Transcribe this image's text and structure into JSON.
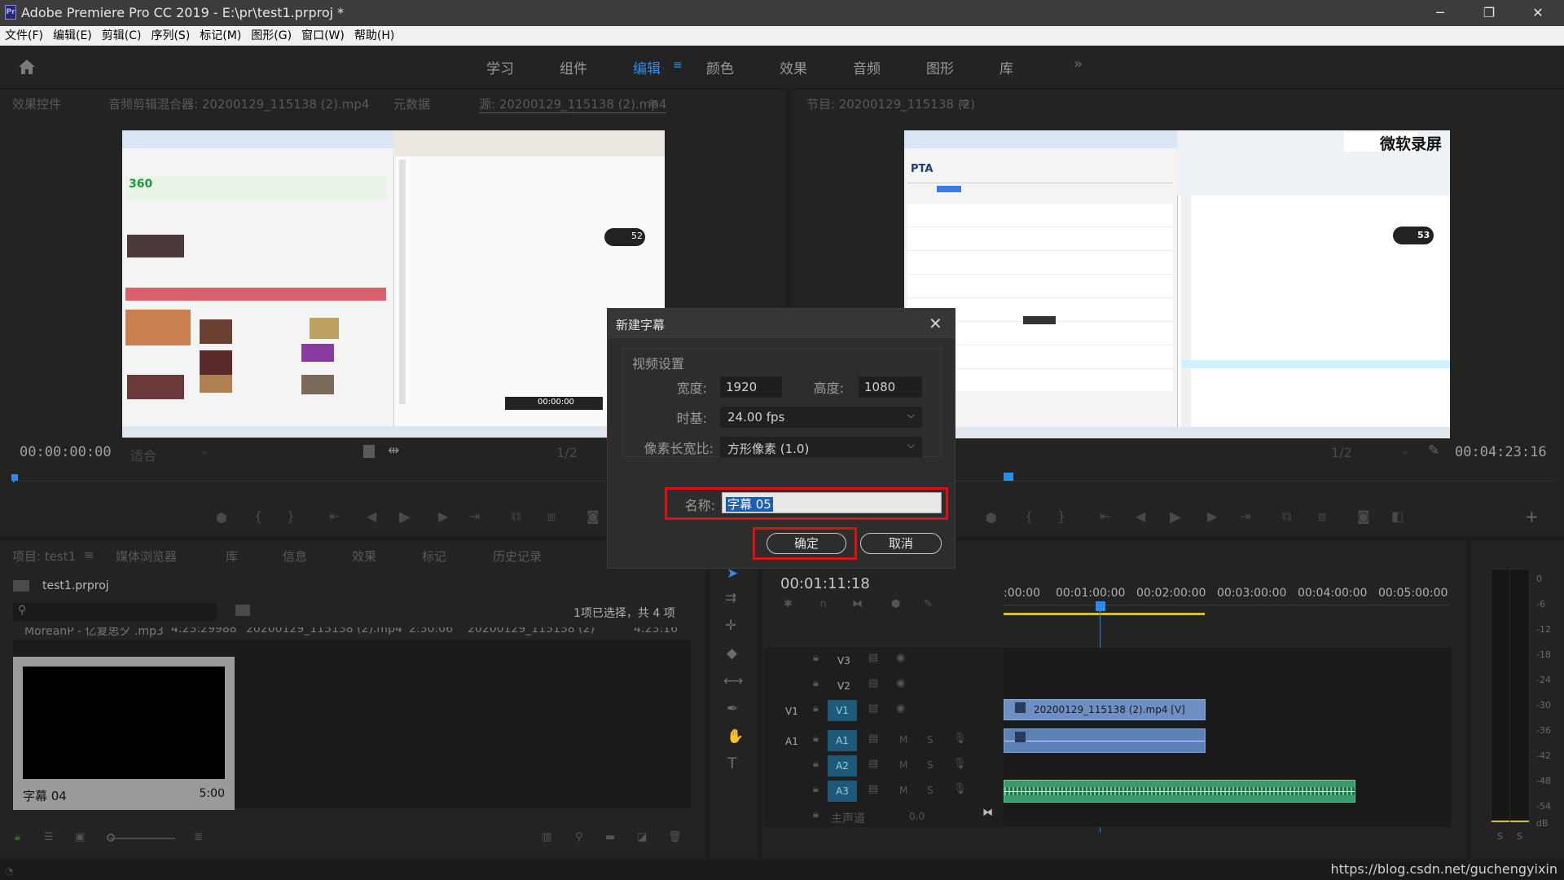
{
  "window": {
    "title": "Adobe Premiere Pro CC 2019 - E:\\pr\\test1.prproj *",
    "app_icon_text": "Pr",
    "minimize": "─",
    "maximize": "❐",
    "close": "✕"
  },
  "menu": [
    "文件(F)",
    "编辑(E)",
    "剪辑(C)",
    "序列(S)",
    "标记(M)",
    "图形(G)",
    "窗口(W)",
    "帮助(H)"
  ],
  "workspaces": [
    {
      "label": "学习",
      "active": false
    },
    {
      "label": "组件",
      "active": false
    },
    {
      "label": "编辑",
      "active": true
    },
    {
      "label": "颜色",
      "active": false
    },
    {
      "label": "效果",
      "active": false
    },
    {
      "label": "音频",
      "active": false
    },
    {
      "label": "图形",
      "active": false
    },
    {
      "label": "库",
      "active": false
    }
  ],
  "workspace_more": "»",
  "source_panel": {
    "tabs": [
      "效果控件",
      "音频剪辑混合器: 20200129_115138 (2).mp4",
      "元数据",
      "源: 20200129_115138 (2).mp4"
    ],
    "timecode": "00:00:00:00",
    "fit": "适合",
    "resolution": "1/2"
  },
  "program_panel": {
    "tab": "节目: 20200129_115138 (2)",
    "timecode": "00:04:23:16",
    "resolution": "1/2",
    "overlay_text": "微软录屏",
    "badge": "53"
  },
  "dialog": {
    "title": "新建字幕",
    "section": "视频设置",
    "width_label": "宽度:",
    "width_value": "1920",
    "height_label": "高度:",
    "height_value": "1080",
    "timebase_label": "时基:",
    "timebase_value": "24.00 fps",
    "pixel_aspect_label": "像素长宽比:",
    "pixel_aspect_value": "方形像素 (1.0)",
    "name_label": "名称:",
    "name_value": "字幕 05",
    "ok_label": "确定",
    "cancel_label": "取消"
  },
  "project_panel": {
    "tabs": [
      "项目: test1",
      "媒体浏览器",
      "库",
      "信息",
      "效果",
      "标记",
      "历史记录"
    ],
    "file_name": "test1.prproj",
    "selection_status": "1项已选择，共 4 项",
    "list_row": [
      "MoreanP - 亿复思夕 .mp3",
      "4:23:29988",
      "20200129_115138 (2).mp4",
      "2:30:06",
      "20200129_115138 (2)",
      "4:23:16"
    ],
    "selected_item": {
      "name": "字幕 04",
      "duration": "5:00"
    }
  },
  "timeline": {
    "timecode": "00:01:11:18",
    "ruler": [
      ":00:00",
      "00:01:00:00",
      "00:02:00:00",
      "00:03:00:00",
      "00:04:00:00",
      "00:05:00:00"
    ],
    "tracks": [
      "V3",
      "V2",
      "V1",
      "A1",
      "A2",
      "A3"
    ],
    "source_patch_v": "V1",
    "source_patch_a": "A1",
    "video_clip": "20200129_115138 (2).mp4 [V]",
    "master_label": "主声道",
    "master_value": "0.0",
    "m": "M",
    "s": "S"
  },
  "meter_labels": [
    "0",
    "-6",
    "-12",
    "-18",
    "-24",
    "-30",
    "-36",
    "-42",
    "-48",
    "-54",
    "dB"
  ],
  "meter_s": "S",
  "watermark": "https://blog.csdn.net/guchengyixin"
}
